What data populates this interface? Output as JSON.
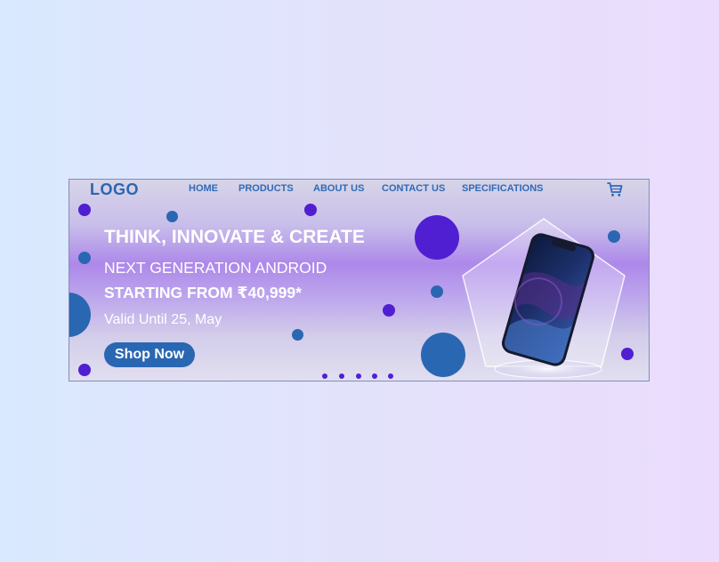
{
  "nav": {
    "logo": "LOGO",
    "links": [
      "HOME",
      "PRODUCTS",
      "ABOUT US",
      "CONTACT US",
      "SPECIFICATIONS"
    ],
    "cart_icon": "cart-icon"
  },
  "hero": {
    "headline": "THINK, INNOVATE & CREATE",
    "subheadline": "NEXT GENERATION ANDROID",
    "price_line": "STARTING FROM ₹40,999*",
    "validity": "Valid Until 25, May",
    "cta_label": "Shop Now",
    "product_image": "smartphone-image"
  },
  "carousel": {
    "slide_count": 5
  },
  "colors": {
    "accent_blue": "#2a67b3",
    "accent_purple": "#4f1fd1",
    "text_light": "#ffffff"
  }
}
